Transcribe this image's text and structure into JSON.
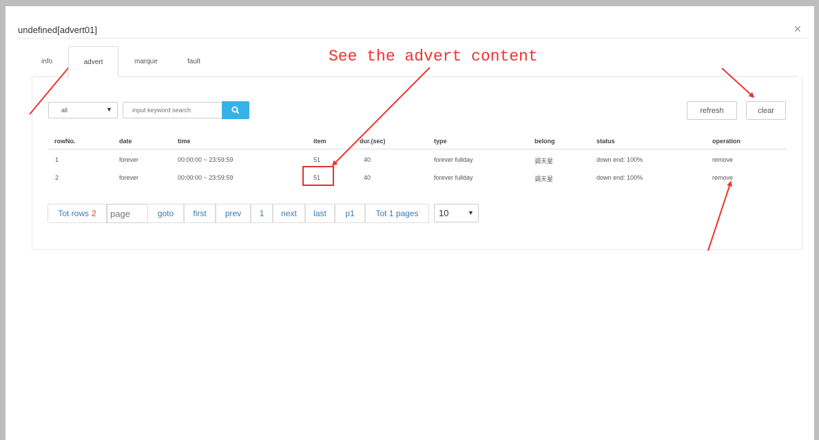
{
  "modal": {
    "title": "undefined[advert01]",
    "close_icon": "close-icon"
  },
  "tabs": [
    {
      "label": "info",
      "active": false
    },
    {
      "label": "advert",
      "active": true
    },
    {
      "label": "marque",
      "active": false
    },
    {
      "label": "fault",
      "active": false
    }
  ],
  "toolbar": {
    "filter_value": "all",
    "search_placeholder": "input keyword search",
    "search_icon": "search-icon",
    "refresh_label": "refresh",
    "clear_label": "clear"
  },
  "table": {
    "headers": [
      "rowNo.",
      "date",
      "time",
      "item",
      "dur.(sec)",
      "type",
      "belong",
      "status",
      "operation"
    ],
    "rows": [
      [
        "1",
        "forever",
        "00:00:00 ~ 23:59:59",
        "51",
        "40",
        "forever fullday",
        "调天星",
        "down end: 100%",
        "remove"
      ],
      [
        "2",
        "forever",
        "00:00:00 ~ 23:59:59",
        "51",
        "40",
        "forever fullday",
        "调天星",
        "down end: 100%",
        "remove"
      ]
    ]
  },
  "pagination": {
    "tot_rows_label": "Tot rows",
    "tot_rows_value": "2",
    "page_placeholder": "page",
    "goto": "goto",
    "first": "first",
    "prev": "prev",
    "current": "1",
    "next": "next",
    "last": "last",
    "page_indicator": "p1",
    "total_pages": "Tot 1 pages",
    "page_size": "10"
  },
  "annotation": {
    "text": "See the advert content",
    "color": "#ee3333"
  },
  "colors": {
    "accent": "#35b3e8",
    "link": "#337ab7",
    "annotation_red": "#e03030"
  }
}
